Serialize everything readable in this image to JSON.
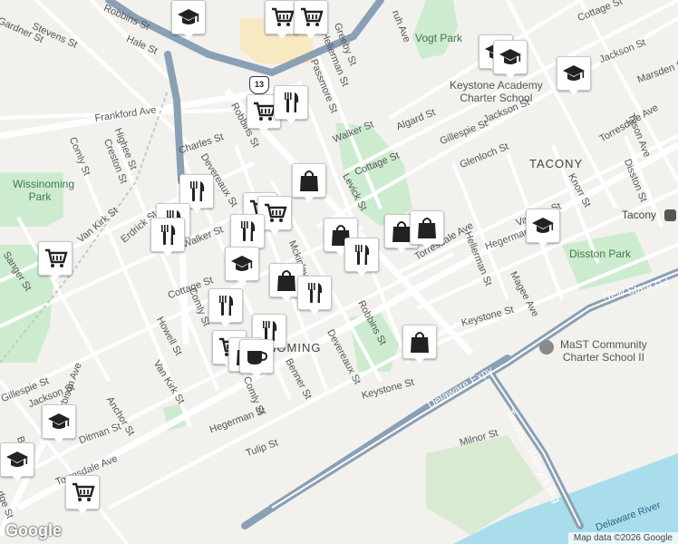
{
  "attribution": "Map data ©2026 Google",
  "logo": "Google",
  "route_shield": "13",
  "neighborhoods": [
    "TACONY",
    "NOMING"
  ],
  "parks": [
    "Wissinoming Park",
    "Vogt Park",
    "Disston Park"
  ],
  "schools": {
    "keystone": "Keystone Academy Charter School",
    "keystone_line1": "Keystone Academy",
    "keystone_line2": "Charter School",
    "mast": "MaST Community Charter School II",
    "mast_line1": "MaST Community",
    "mast_line2": "Charter School II"
  },
  "places": [
    "Tacony",
    "Delaware River"
  ],
  "roads": {
    "delaware_expy": "Delaware Expy",
    "tacony_palmyra": "Tacony - Palmyra Brg",
    "new_state_rd": "New State Rd",
    "frankford_ave": "Frankford Ave",
    "torresdale_ave_w": "Torresdale Ave",
    "torresdale_ave_mid": "Torresdale Ave",
    "torresdale_ave_e": "Torresdale Ave",
    "robbins_st_n": "Robbins St",
    "robbins_st_s": "Robbins St",
    "levick_st": "Levick St",
    "keystone_st_w": "Keystone St",
    "keystone_st_e": "Keystone St",
    "hegerman_st_w": "Hegerman St",
    "hegerman_st_e": "Hegerman St",
    "cottage_st_w": "Cottage St",
    "cottage_st_mid": "Cottage St",
    "cottage_st_ne": "Cottage St",
    "walker_st_w": "Walker St",
    "walker_st_e": "Walker St",
    "vandike_st": "Vandike St",
    "jackson_st_ne": "Jackson St",
    "jackson_st_mid": "Jackson St",
    "jackson_st_sw": "Jackson St",
    "gillespie_st_mid": "Gillespie St",
    "gillespie_st_sw": "Gillespie St",
    "glenloch_st": "Glenloch St",
    "algard_st": "Algard St",
    "hellerman_st_n": "Hellerman St",
    "hellerman_st_s": "Hellerman St",
    "greeby_st": "Greeby St",
    "passmore_st": "Passmore St",
    "charles_st": "Charles St",
    "devereaux_st_n": "Devereaux St",
    "devereaux_st_s": "Devereaux St",
    "highee_st": "Highee St",
    "creston_st": "Creston St",
    "comly_st_w": "Comly St",
    "comly_st_mid": "Comly St",
    "comly_st_s": "Comly St",
    "erdrick_st": "Erdrick St",
    "van_kirk_st_n": "Van Kirk St",
    "van_kirk_st_s": "Van Kirk St",
    "howell_st": "Howell St",
    "sanger_st": "Sanger St",
    "benner_st": "Benner St",
    "tulip_st": "Tulip St",
    "milnor_st": "Milnor St",
    "magee_ave": "Magee Ave",
    "knorr_st": "Knorr St",
    "disston_st": "Disston St",
    "tyson_ave": "Tyson Ave",
    "marsden_st": "Marsden St",
    "stevens_st": "Stevens St",
    "hale_st": "Hale St",
    "harbison_ave": "Harbison Ave",
    "ditman_st": "Ditman St",
    "anchor_st": "Anchor St",
    "bill_st": "Bill St",
    "mckinley": "Mckinley",
    "robbins_top": "Robbins St",
    "gardner_st": "Gardner St",
    "ruh_ave": "ruh Ave",
    "dge_st": "dge St"
  },
  "markers": [
    {
      "type": "school"
    },
    {
      "type": "grocery"
    },
    {
      "type": "grocery"
    },
    {
      "type": "grocery"
    },
    {
      "type": "restaurant"
    },
    {
      "type": "school"
    },
    {
      "type": "school"
    },
    {
      "type": "school"
    },
    {
      "type": "shopping"
    },
    {
      "type": "restaurant"
    },
    {
      "type": "restaurant"
    },
    {
      "type": "grocery"
    },
    {
      "type": "grocery"
    },
    {
      "type": "restaurant"
    },
    {
      "type": "restaurant"
    },
    {
      "type": "shopping"
    },
    {
      "type": "restaurant"
    },
    {
      "type": "grocery"
    },
    {
      "type": "school"
    },
    {
      "type": "shopping"
    },
    {
      "type": "restaurant"
    },
    {
      "type": "restaurant"
    },
    {
      "type": "school"
    },
    {
      "type": "shopping"
    },
    {
      "type": "shopping"
    },
    {
      "type": "shopping"
    },
    {
      "type": "restaurant"
    },
    {
      "type": "grocery"
    },
    {
      "type": "school"
    },
    {
      "type": "shopping"
    },
    {
      "type": "school"
    },
    {
      "type": "grocery"
    },
    {
      "type": "cafe"
    }
  ],
  "colors": {
    "land": "#f2f1ee",
    "park": "#cdeccf",
    "water": "#a9ddeb",
    "highway": "#8aa0b4",
    "road": "#ffffff",
    "campus": "#f7e9c2"
  }
}
